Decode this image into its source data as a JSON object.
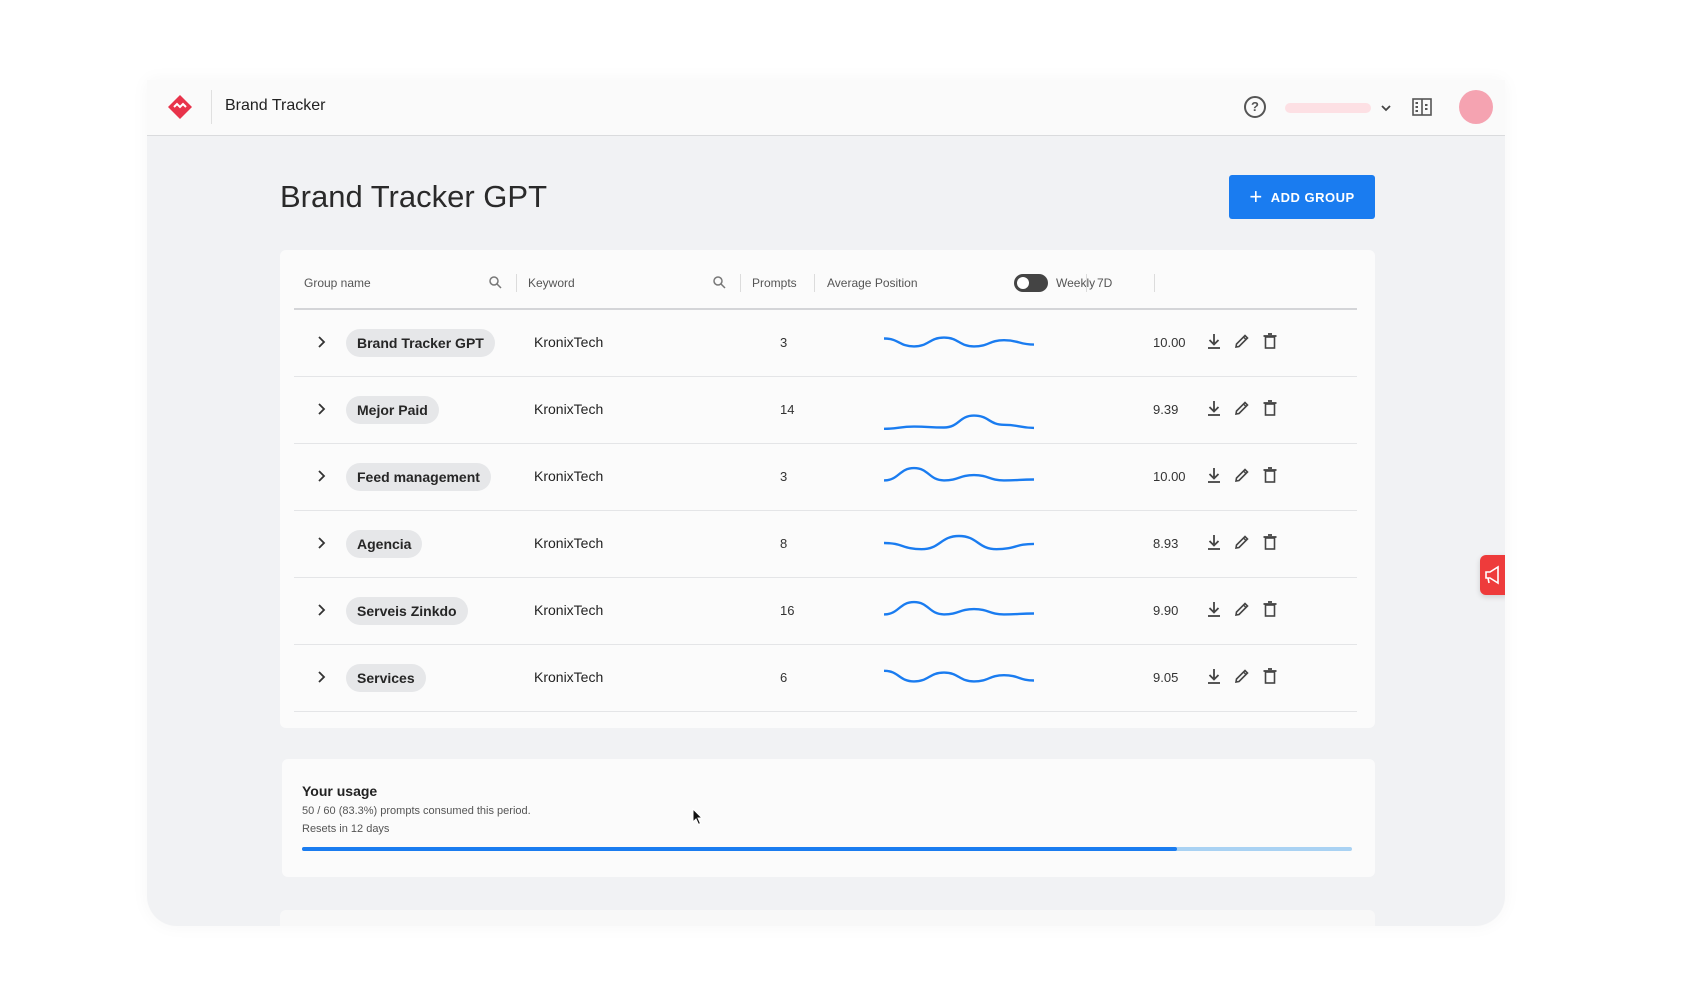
{
  "header": {
    "app_title": "Brand Tracker"
  },
  "page": {
    "title": "Brand Tracker GPT",
    "add_group_label": "ADD GROUP"
  },
  "table": {
    "columns": {
      "group_name": "Group name",
      "keyword": "Keyword",
      "prompts": "Prompts",
      "average_position": "Average Position",
      "toggle_label": "Weekly",
      "period": "7D"
    },
    "rows": [
      {
        "group": "Brand Tracker GPT",
        "keyword": "KronixTech",
        "prompts": "3",
        "avg": "10.00",
        "trend": [
          4.2,
          6.0,
          4.0,
          6.0,
          4.6,
          5.6
        ]
      },
      {
        "group": "Mejor Paid",
        "keyword": "KronixTech",
        "prompts": "14",
        "avg": "9.39",
        "trend": [
          9.5,
          9.0,
          9.2,
          6.5,
          8.6,
          9.3
        ]
      },
      {
        "group": "Feed management",
        "keyword": "KronixTech",
        "prompts": "3",
        "avg": "10.00",
        "trend": [
          6.0,
          3.2,
          6.0,
          4.8,
          6.0,
          5.8
        ]
      },
      {
        "group": "Agencia",
        "keyword": "KronixTech",
        "prompts": "8",
        "avg": "8.93",
        "trend": [
          5.0,
          6.4,
          3.4,
          6.4,
          5.2
        ]
      },
      {
        "group": "Serveis Zinkdo",
        "keyword": "KronixTech",
        "prompts": "16",
        "avg": "9.90",
        "trend": [
          6.0,
          3.2,
          6.0,
          4.8,
          6.0,
          5.8
        ]
      },
      {
        "group": "Services",
        "keyword": "KronixTech",
        "prompts": "6",
        "avg": "9.05",
        "trend": [
          3.6,
          6.0,
          4.0,
          6.0,
          4.6,
          5.8
        ]
      }
    ]
  },
  "usage": {
    "title": "Your usage",
    "detail": "50 / 60 (83.3%) prompts consumed this period.",
    "reset": "Resets in 12 days",
    "fraction": 0.833
  },
  "colors": {
    "accent": "#1a7cf0",
    "brand_red": "#e8334a",
    "avatar": "#f5a3b1"
  },
  "icons": [
    "logo-icon",
    "help-icon",
    "chevron-down-icon",
    "building-icon",
    "search-icon",
    "chevron-right-icon",
    "download-icon",
    "edit-icon",
    "trash-icon",
    "megaphone-icon"
  ]
}
